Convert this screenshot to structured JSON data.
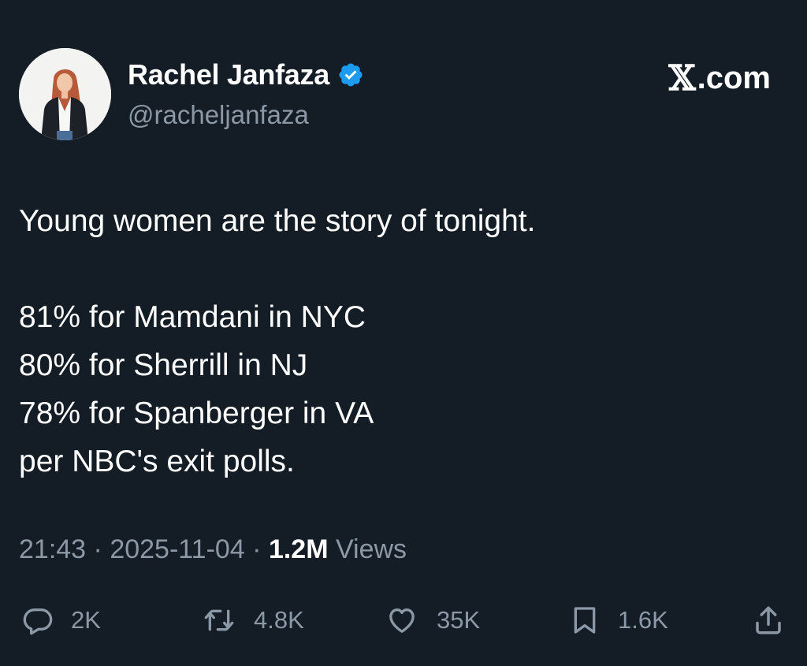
{
  "author": {
    "name": "Rachel Janfaza",
    "handle": "@racheljanfaza",
    "verified": true
  },
  "brand": {
    "symbol": "𝕏",
    "suffix": ".com"
  },
  "tweet": {
    "lines": [
      "Young women are the story of tonight.",
      "",
      "81% for Mamdani in NYC",
      "80% for Sherrill in NJ",
      "78% for Spanberger in VA",
      "per NBC's exit polls."
    ]
  },
  "meta": {
    "time": "21:43",
    "separator": " · ",
    "date": "2025-11-04",
    "views_count": "1.2M",
    "views_label": " Views"
  },
  "actions": {
    "replies": {
      "icon": "reply-icon",
      "count": "2K"
    },
    "reposts": {
      "icon": "repost-icon",
      "count": "4.8K"
    },
    "likes": {
      "icon": "heart-icon",
      "count": "35K"
    },
    "bookmarks": {
      "icon": "bookmark-icon",
      "count": "1.6K"
    },
    "share": {
      "icon": "share-icon"
    }
  },
  "colors": {
    "background": "#141d26",
    "text": "#ffffff",
    "muted": "#8b98a5",
    "verified": "#1d9bf0"
  }
}
